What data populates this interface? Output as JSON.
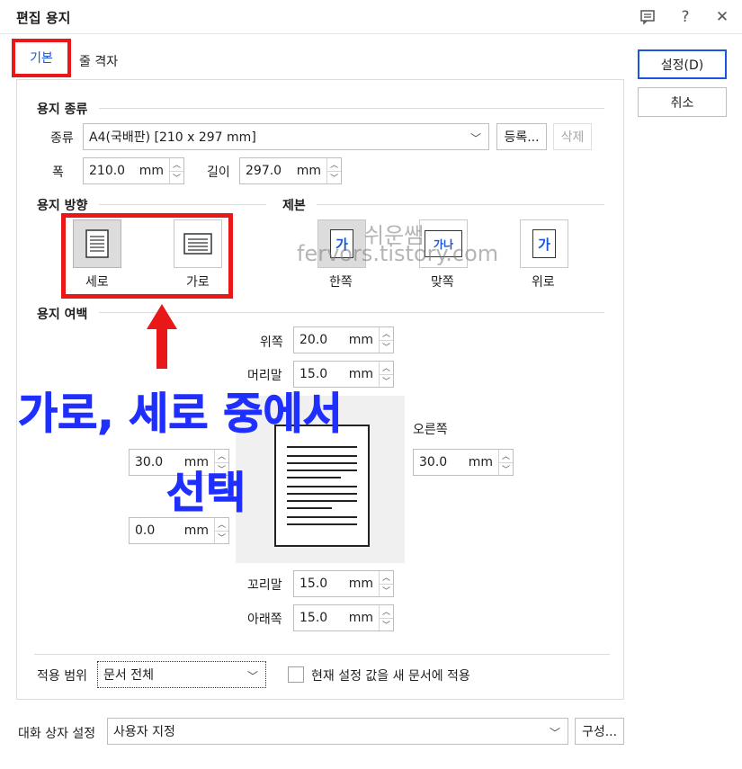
{
  "window": {
    "title": "편집 용지"
  },
  "titlebar_icons": [
    "comment-icon",
    "help-icon",
    "close-icon"
  ],
  "titlebar_glyphs": {
    "comment": "☰",
    "help": "?",
    "close": "✕"
  },
  "tabs": [
    {
      "label": "기본",
      "active": true
    },
    {
      "label": "줄 격자",
      "active": false
    }
  ],
  "buttons": {
    "ok": "설정(D)",
    "cancel": "취소"
  },
  "paper_type": {
    "section": "용지 종류",
    "kind_label": "종류",
    "kind_value": "A4(국배판)  [210 x 297 mm]",
    "register_button": "등록...",
    "delete_button": "삭제",
    "width_label": "폭",
    "width_value": "210.0",
    "height_label": "길이",
    "height_value": "297.0",
    "unit": "mm"
  },
  "orientation": {
    "section": "용지 방향",
    "portrait": "세로",
    "landscape": "가로",
    "selected": "세로"
  },
  "binding": {
    "section": "제본",
    "options": [
      {
        "label": "한쪽",
        "glyph": "가"
      },
      {
        "label": "맞쪽",
        "glyph": "가나"
      },
      {
        "label": "위로",
        "glyph": "가"
      }
    ],
    "selected": "한쪽"
  },
  "margins": {
    "section": "용지 여백",
    "top_label": "위쪽",
    "top_value": "20.0",
    "header_label": "머리말",
    "header_value": "15.0",
    "left_value": "30.0",
    "right_label": "오른쪽",
    "right_value": "30.0",
    "gutter_value": "0.0",
    "footer_label": "꼬리말",
    "footer_value": "15.0",
    "bottom_label": "아래쪽",
    "bottom_value": "15.0",
    "unit": "mm"
  },
  "apply": {
    "range_label": "적용 범위",
    "range_value": "문서 전체",
    "new_doc_checkbox_label": "현재 설정 값을 새 문서에 적용",
    "new_doc_checked": false
  },
  "dialog_settings": {
    "label": "대화 상자 설정",
    "value": "사용자 지정",
    "config_button": "구성..."
  },
  "annotation": {
    "line1": "가로, 세로 중에서",
    "line2": "선택",
    "color": "#1e2fff",
    "frame_color": "#e81818"
  },
  "watermark": {
    "line1": "쉬운쌤",
    "line2": "fervors.tistory.com"
  }
}
